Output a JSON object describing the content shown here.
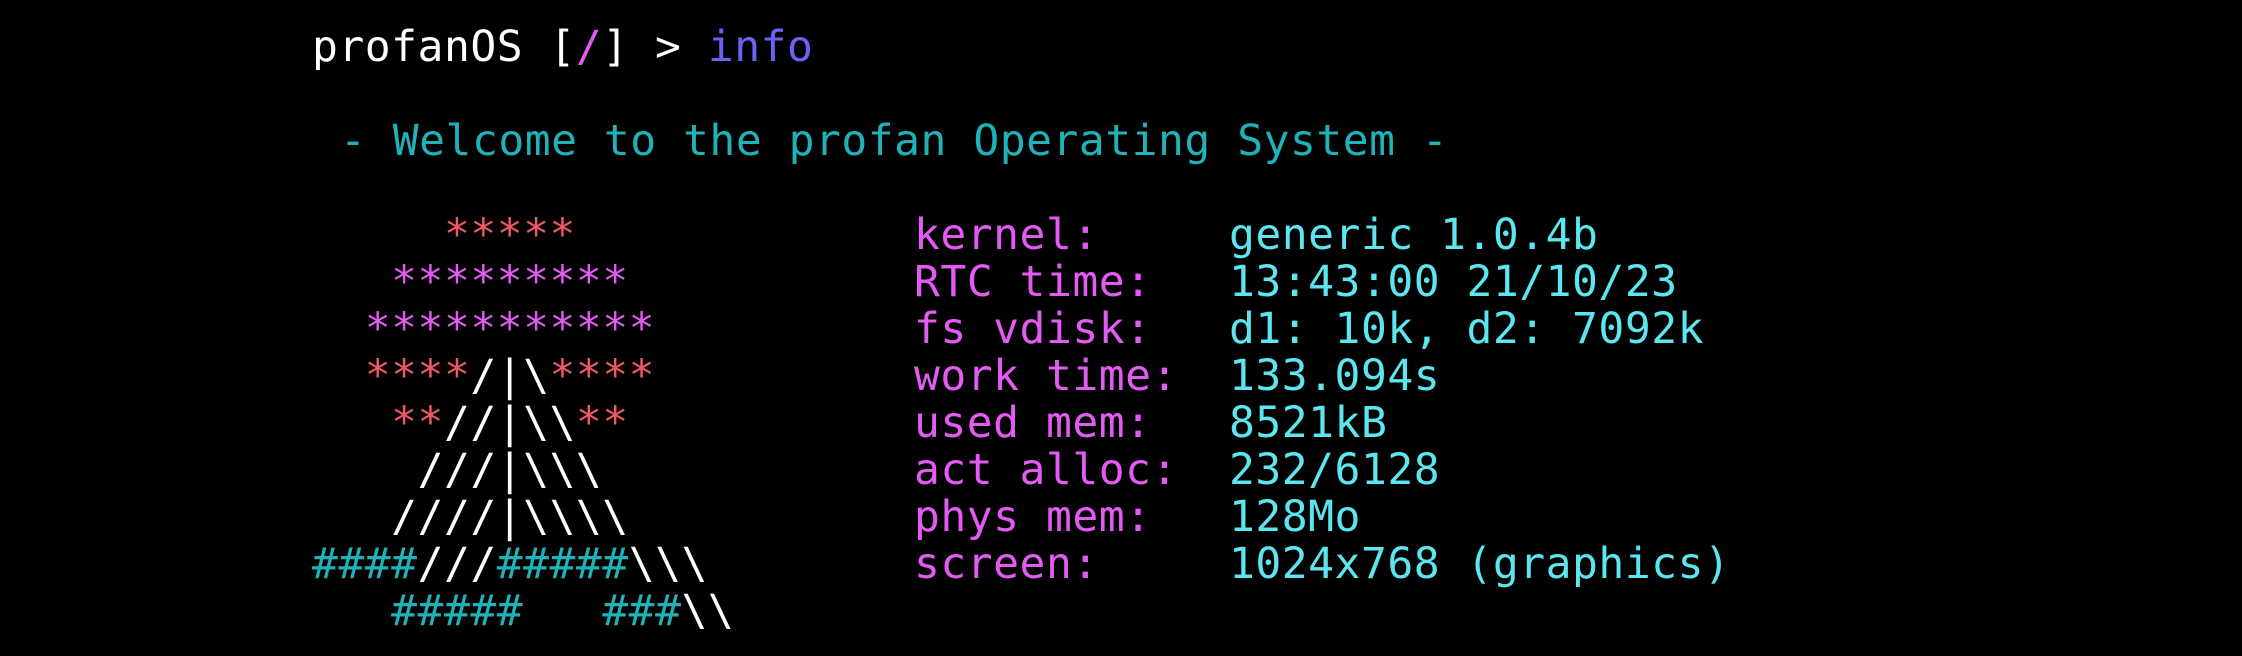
{
  "terminal": {
    "prompt": {
      "host": "profanOS",
      "open": " [",
      "path": "/",
      "close": "] > ",
      "command": "info"
    },
    "welcome": "- Welcome to the profan Operating System -",
    "logo": [
      [
        {
          "t": "     ",
          "c": "white"
        },
        {
          "t": "*****",
          "c": "red"
        }
      ],
      [
        {
          "t": "   ",
          "c": "white"
        },
        {
          "t": "*********",
          "c": "pink"
        }
      ],
      [
        {
          "t": "  ",
          "c": "white"
        },
        {
          "t": "***********",
          "c": "pink"
        }
      ],
      [
        {
          "t": "  ",
          "c": "white"
        },
        {
          "t": "****",
          "c": "red"
        },
        {
          "t": "/|\\",
          "c": "white"
        },
        {
          "t": "****",
          "c": "red"
        }
      ],
      [
        {
          "t": "   ",
          "c": "white"
        },
        {
          "t": "**",
          "c": "red"
        },
        {
          "t": "//|\\\\",
          "c": "white"
        },
        {
          "t": "**",
          "c": "red"
        }
      ],
      [
        {
          "t": "    ",
          "c": "white"
        },
        {
          "t": "///|\\\\\\",
          "c": "white"
        }
      ],
      [
        {
          "t": "   ",
          "c": "white"
        },
        {
          "t": "////|\\\\\\\\",
          "c": "white"
        }
      ],
      [
        {
          "t": "####",
          "c": "cyan"
        },
        {
          "t": "///",
          "c": "white"
        },
        {
          "t": "#####",
          "c": "cyan"
        },
        {
          "t": "\\\\\\",
          "c": "white"
        }
      ],
      [
        {
          "t": "   ",
          "c": "white"
        },
        {
          "t": "#####",
          "c": "cyan"
        },
        {
          "t": "   ",
          "c": "white"
        },
        {
          "t": "###",
          "c": "cyan"
        },
        {
          "t": "\\\\",
          "c": "white"
        }
      ]
    ],
    "info": [
      {
        "label": "kernel:",
        "value": "generic 1.0.4b"
      },
      {
        "label": "RTC time:",
        "value": "13:43:00 21/10/23"
      },
      {
        "label": "fs vdisk:",
        "value": "d1: 10k, d2: 7092k"
      },
      {
        "label": "work time:",
        "value": "133.094s"
      },
      {
        "label": "used mem:",
        "value": "8521kB"
      },
      {
        "label": "act alloc:",
        "value": "232/6128"
      },
      {
        "label": "phys mem:",
        "value": "128Mo"
      },
      {
        "label": "screen:",
        "value": "1024x768 (graphics)"
      }
    ]
  },
  "colors": {
    "background": "#000000",
    "white": "#ffffff",
    "cyan": "#1fb2b9",
    "pink": "#e35bf2",
    "red": "#ef5a62",
    "blue": "#6a63f6",
    "value": "#5ce6f0"
  }
}
